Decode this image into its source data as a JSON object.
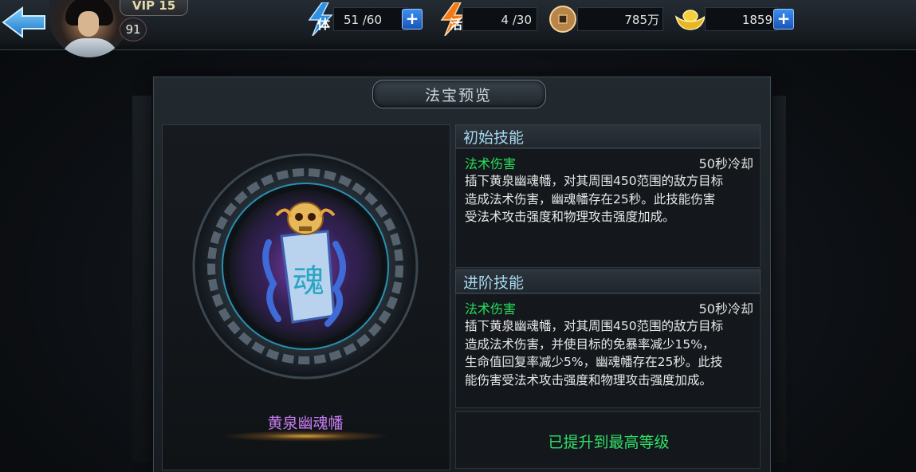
{
  "player": {
    "vip": "VIP 15",
    "level": "91"
  },
  "resources": {
    "stamina": {
      "icon_label": "体",
      "value": "51 /60"
    },
    "vitality": {
      "icon_label": "活",
      "value": "4 /30"
    },
    "coins": {
      "value": "785万"
    },
    "ingots": {
      "value": "1859"
    }
  },
  "panel": {
    "title": "法宝预览",
    "item_name": "黄泉幽魂幡",
    "emblem_glyph": "魂"
  },
  "skills": [
    {
      "header": "初始技能",
      "type": "法术伤害",
      "cooldown": "50秒冷却",
      "lines": [
        "插下黄泉幽魂幡，对其周围450范围的敌方目标",
        "造成法术伤害，幽魂幡存在25秒。此技能伤害",
        "受法术攻击强度和物理攻击强度加成。"
      ]
    },
    {
      "header": "进阶技能",
      "type": "法术伤害",
      "cooldown": "50秒冷却",
      "lines": [
        "插下黄泉幽魂幡，对其周围450范围的敌方目标",
        "造成法术伤害，并使目标的免暴率减少15%，",
        "生命值回复率减少5%，幽魂幡存在25秒。此技",
        "能伤害受法术攻击强度和物理攻击强度加成。"
      ]
    }
  ],
  "status": {
    "max_level": "已提升到最高等级"
  },
  "colors": {
    "accent_blue": "#a8d8ef",
    "skill_type_green": "#27e05a",
    "item_name_purple": "#c77cf2",
    "plus_button_blue": "#2a6fd6"
  }
}
